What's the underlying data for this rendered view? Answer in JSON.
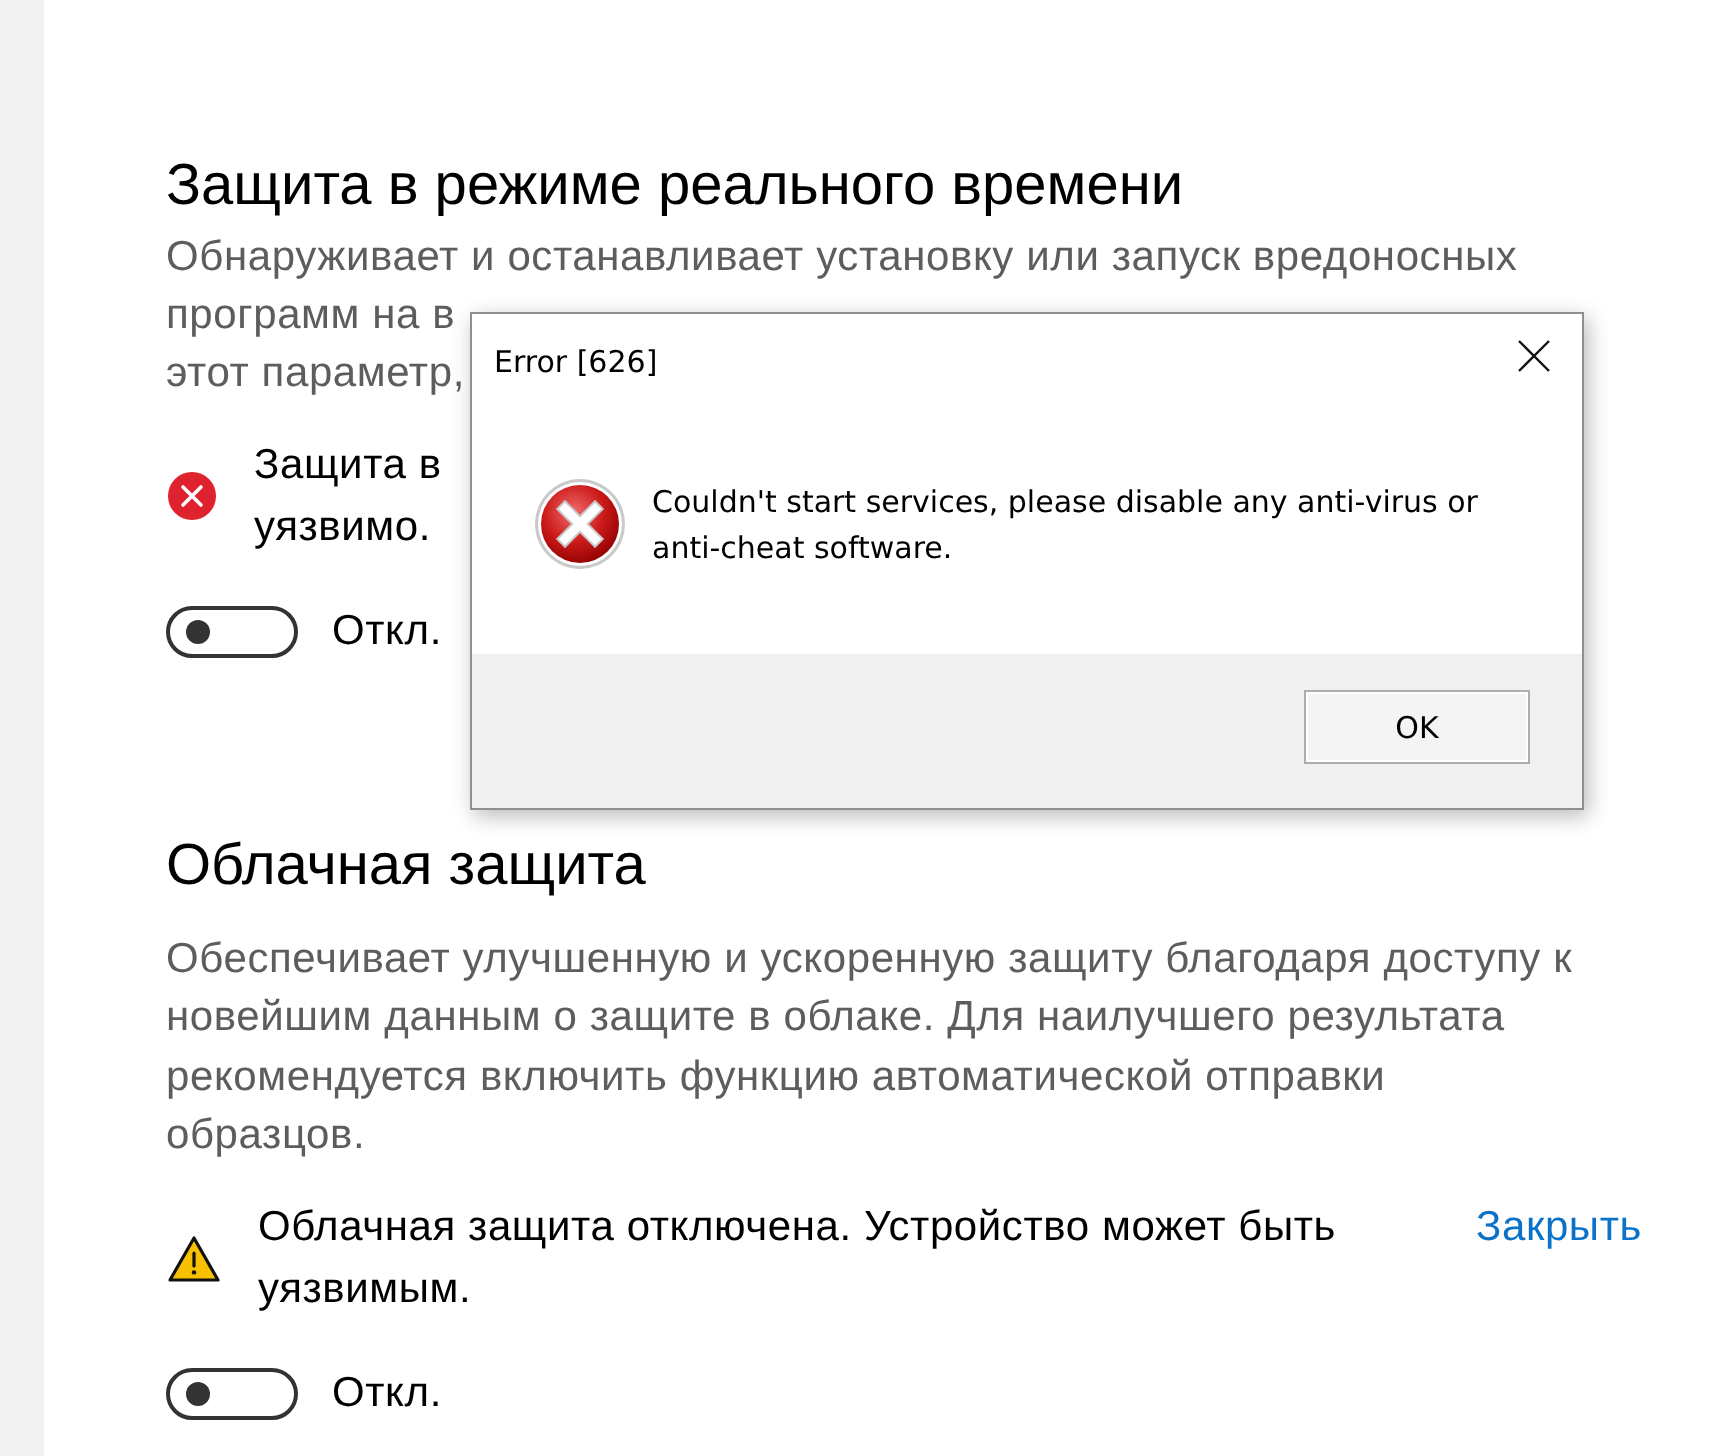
{
  "sections": [
    {
      "title": "Защита в режиме реального времени",
      "description_lines": [
        "Обнаруживает и останавливает установку или запуск вредоносных",
        "программ на в",
        "этот параметр,"
      ],
      "status": {
        "kind": "error",
        "lines": [
          "Защита в",
          "уязвимо."
        ]
      },
      "toggle": {
        "on": false,
        "label": "Откл."
      }
    },
    {
      "title": "Облачная защита",
      "description": "Обеспечивает улучшенную и ускоренную защиту благодаря доступу к новейшим данным о защите в облаке. Для наилучшего результата рекомендуется включить функцию автоматической отправки образцов.",
      "status": {
        "kind": "warning",
        "text": "Облачная защита отключена. Устройство может быть уязвимым.",
        "link": "Закрыть"
      },
      "toggle": {
        "on": false,
        "label": "Откл."
      }
    }
  ],
  "dialog": {
    "title": "Error [626]",
    "message": "Couldn't start services, please disable any anti-virus or anti-cheat software.",
    "buttons": [
      "OK"
    ]
  }
}
